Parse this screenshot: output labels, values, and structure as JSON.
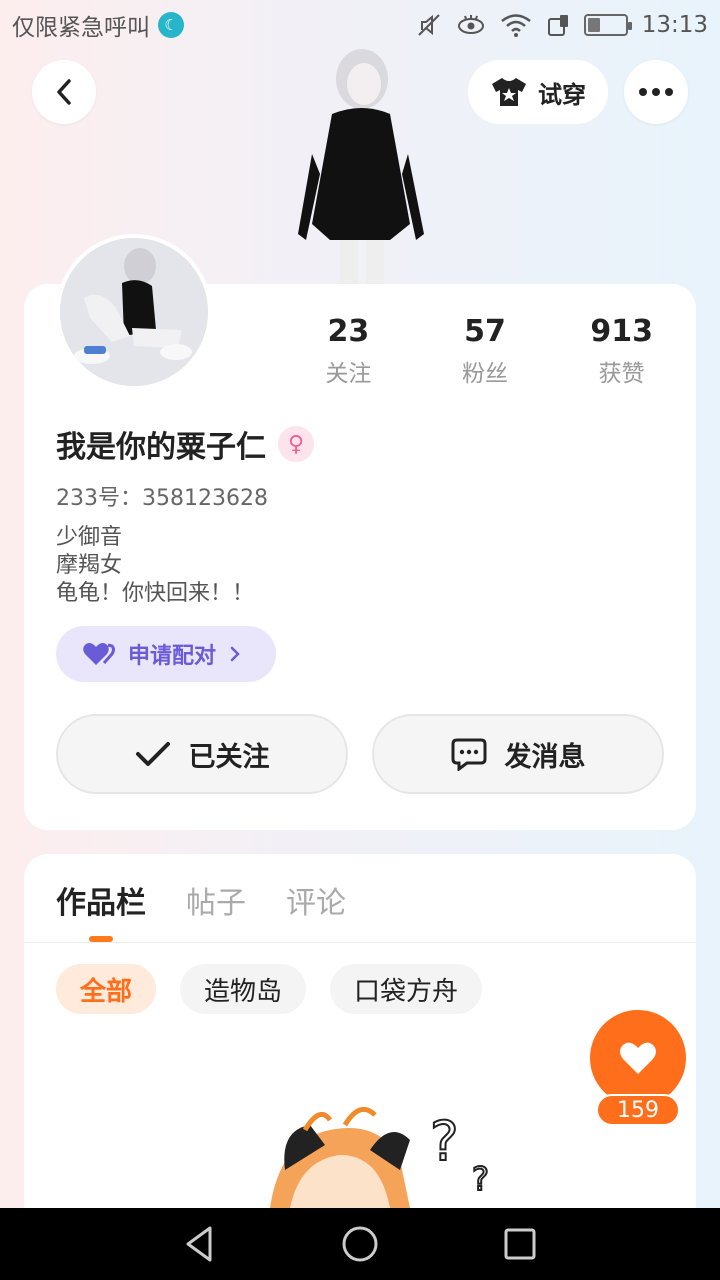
{
  "status_bar": {
    "carrier": "仅限紧急呼叫",
    "time": "13:13",
    "battery_level": 0.35
  },
  "header": {
    "back_icon": "chevron-left-icon",
    "try_on_label": "试穿",
    "more_icon": "more-dots-icon"
  },
  "profile": {
    "stats": [
      {
        "value": "23",
        "label": "关注"
      },
      {
        "value": "57",
        "label": "粉丝"
      },
      {
        "value": "913",
        "label": "获赞"
      }
    ],
    "name": "我是你的粟子仁",
    "gender_icon": "female-icon",
    "uid": "233号：358123628",
    "bio": [
      "少御音",
      "摩羯女",
      "龟龟！你快回来！！"
    ],
    "pair_button": "申请配对",
    "follow_button": "已关注",
    "message_button": "发消息"
  },
  "content": {
    "tabs": [
      "作品栏",
      "帖子",
      "评论"
    ],
    "active_tab": 0,
    "filters": [
      "全部",
      "造物岛",
      "口袋方舟"
    ],
    "active_filter": 0,
    "like_count": "159"
  },
  "colors": {
    "accent": "#ff6e1a",
    "pair_bg": "#e9e6fb",
    "pair_text": "#6a5bd6"
  }
}
